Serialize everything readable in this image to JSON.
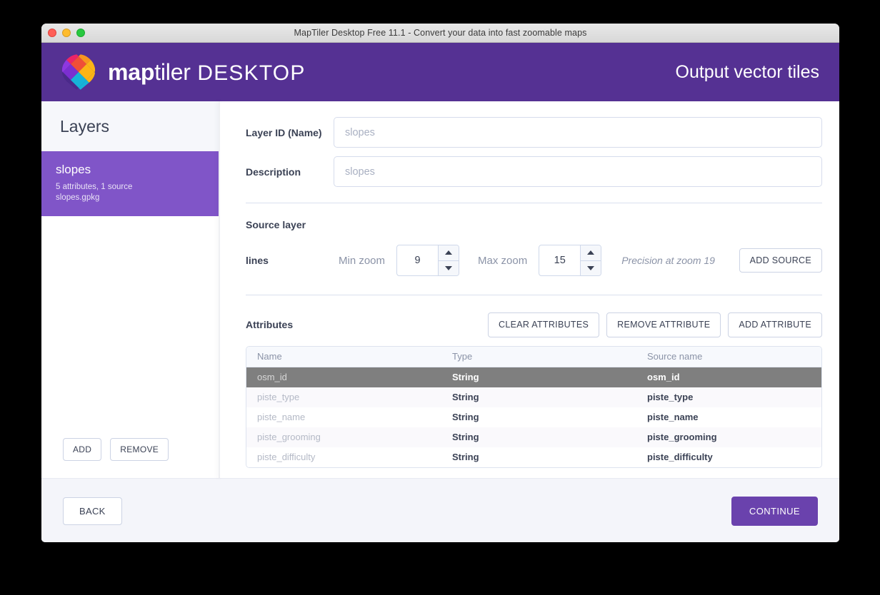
{
  "window": {
    "title": "MapTiler Desktop Free 11.1 - Convert your data into fast zoomable maps",
    "traffic_lights": [
      "close",
      "minimize",
      "zoom"
    ]
  },
  "header": {
    "brand_bold": "map",
    "brand_light": "tiler",
    "brand_product": "DESKTOP",
    "title": "Output vector tiles",
    "background_color": "#553193"
  },
  "sidebar": {
    "title": "Layers",
    "layers": [
      {
        "name": "slopes",
        "meta_line1": "5 attributes, 1 source",
        "meta_line2": "slopes.gpkg",
        "selected": true,
        "selected_color": "#8055c8"
      }
    ],
    "add_label": "ADD",
    "remove_label": "REMOVE"
  },
  "main": {
    "layer_id": {
      "label": "Layer ID (Name)",
      "value": "",
      "placeholder": "slopes"
    },
    "description": {
      "label": "Description",
      "value": "",
      "placeholder": "slopes"
    },
    "source_layer": {
      "section_title": "Source layer",
      "name": "lines",
      "min_zoom_label": "Min zoom",
      "min_zoom_value": "9",
      "max_zoom_label": "Max zoom",
      "max_zoom_value": "15",
      "precision_note": "Precision at zoom 19",
      "add_source_label": "ADD SOURCE"
    },
    "attributes": {
      "section_title": "Attributes",
      "clear_label": "CLEAR ATTRIBUTES",
      "remove_label": "REMOVE ATTRIBUTE",
      "add_label": "ADD ATTRIBUTE",
      "columns": [
        "Name",
        "Type",
        "Source name"
      ],
      "rows": [
        {
          "name": "osm_id",
          "type": "String",
          "source_name": "osm_id",
          "selected": true
        },
        {
          "name": "piste_type",
          "type": "String",
          "source_name": "piste_type",
          "selected": false
        },
        {
          "name": "piste_name",
          "type": "String",
          "source_name": "piste_name",
          "selected": false
        },
        {
          "name": "piste_grooming",
          "type": "String",
          "source_name": "piste_grooming",
          "selected": false
        },
        {
          "name": "piste_difficulty",
          "type": "String",
          "source_name": "piste_difficulty",
          "selected": false
        }
      ],
      "selected_row_color": "#7f7f7f"
    }
  },
  "footer": {
    "back_label": "BACK",
    "continue_label": "CONTINUE",
    "continue_color": "#6a42ad"
  }
}
